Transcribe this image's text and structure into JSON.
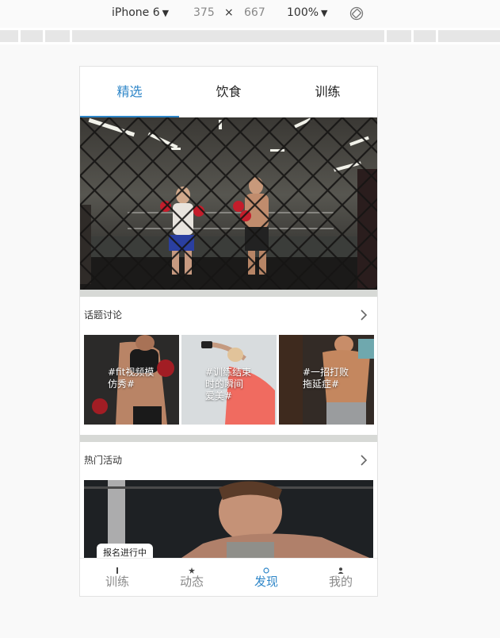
{
  "devtools": {
    "device": "iPhone 6",
    "width": "375",
    "times": "×",
    "height": "667",
    "zoom": "100%"
  },
  "tabs": [
    {
      "label": "精选",
      "active": true
    },
    {
      "label": "饮食",
      "active": false
    },
    {
      "label": "训练",
      "active": false
    }
  ],
  "topics": {
    "title": "话题讨论",
    "items": [
      {
        "label_line1": "#fit视频模",
        "label_line2": "仿秀#"
      },
      {
        "label_line1": "#训练结束",
        "label_line2": "时的瞬间",
        "label_line3": "爱美#"
      },
      {
        "label_line1": "#一招打败",
        "label_line2": "拖延症#"
      }
    ]
  },
  "events": {
    "title": "热门活动",
    "badge": "报名进行中"
  },
  "bottom_nav": [
    {
      "label": "训练",
      "icon": "dumbbell-icon",
      "active": false
    },
    {
      "label": "动态",
      "icon": "star-icon",
      "active": false
    },
    {
      "label": "发现",
      "icon": "compass-icon",
      "active": true
    },
    {
      "label": "我的",
      "icon": "user-icon",
      "active": false
    }
  ],
  "colors": {
    "accent": "#2e86c8",
    "divider": "#d7d9d6"
  }
}
